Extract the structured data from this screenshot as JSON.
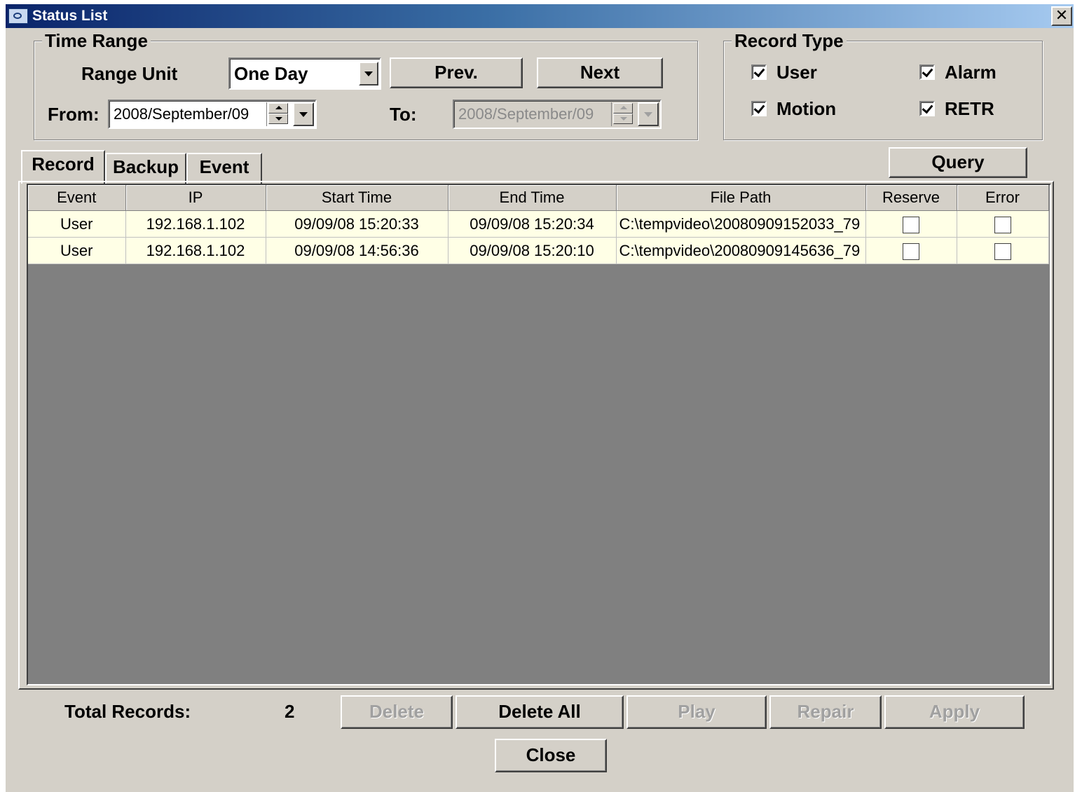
{
  "window": {
    "title": "Status List",
    "close_label": "✕"
  },
  "time_range": {
    "legend": "Time Range",
    "range_unit_label": "Range Unit",
    "range_unit_value": "One Day",
    "prev_label": "Prev.",
    "next_label": "Next",
    "from_label": "From:",
    "from_value": "2008/September/09",
    "to_label": "To:",
    "to_value": "2008/September/09"
  },
  "record_type": {
    "legend": "Record Type",
    "options": [
      {
        "label": "User",
        "checked": true
      },
      {
        "label": "Alarm",
        "checked": true
      },
      {
        "label": "Motion",
        "checked": true
      },
      {
        "label": "RETR",
        "checked": true
      }
    ]
  },
  "tabs": [
    {
      "label": "Record",
      "active": true
    },
    {
      "label": "Backup",
      "active": false
    },
    {
      "label": "Event",
      "active": false
    }
  ],
  "query_label": "Query",
  "table": {
    "columns": [
      "Event",
      "IP",
      "Start Time",
      "End Time",
      "File Path",
      "Reserve",
      "Error"
    ],
    "rows": [
      {
        "event": "User",
        "ip": "192.168.1.102",
        "start": "09/09/08 15:20:33",
        "end": "09/09/08 15:20:34",
        "path": "C:\\tempvideo\\20080909152033_79",
        "reserve": false,
        "error": false
      },
      {
        "event": "User",
        "ip": "192.168.1.102",
        "start": "09/09/08 14:56:36",
        "end": "09/09/08 15:20:10",
        "path": "C:\\tempvideo\\20080909145636_79",
        "reserve": false,
        "error": false
      }
    ]
  },
  "footer": {
    "total_label": "Total Records:",
    "total_value": "2",
    "delete_label": "Delete",
    "delete_all_label": "Delete All",
    "play_label": "Play",
    "repair_label": "Repair",
    "apply_label": "Apply",
    "close_label": "Close"
  },
  "colors": {
    "title_start": "#0a246a",
    "title_end": "#a6caf0",
    "face": "#d4d0c8",
    "row_bg": "#ffffe6",
    "grid_bg": "#808080"
  }
}
